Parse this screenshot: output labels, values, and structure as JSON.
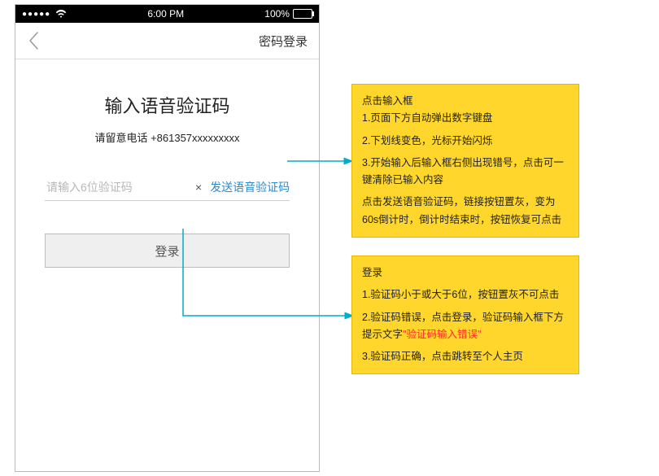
{
  "status": {
    "signal_dots": "●●●●●",
    "time": "6:00 PM",
    "battery_pct": "100%"
  },
  "nav": {
    "right_link": "密码登录"
  },
  "page": {
    "title": "输入语音验证码",
    "subtitle": "请留意电话 +861357xxxxxxxxx"
  },
  "input": {
    "placeholder": "请输入6位验证码",
    "clear_symbol": "×",
    "send_link": "发送语音验证码"
  },
  "login": {
    "button_label": "登录"
  },
  "notes": {
    "box1": {
      "heading": "点击输入框",
      "l1": "1.页面下方自动弹出数字键盘",
      "l2": "2.下划线变色，光标开始闪烁",
      "l3": "3.开始输入后输入框右侧出现错号，点击可一键清除已输入内容",
      "l4": "点击发送语音验证码，链接按钮置灰，变为60s倒计时，倒计时结束时，按钮恢复可点击"
    },
    "box2": {
      "heading": "登录",
      "l1": "1.验证码小于或大于6位，按钮置灰不可点击",
      "l2a": "2.验证码错误，点击登录，验证码输入框下方提示文字",
      "l2b": "\"验证码输入错误\"",
      "l3": "3.验证码正确，点击跳转至个人主页"
    }
  }
}
